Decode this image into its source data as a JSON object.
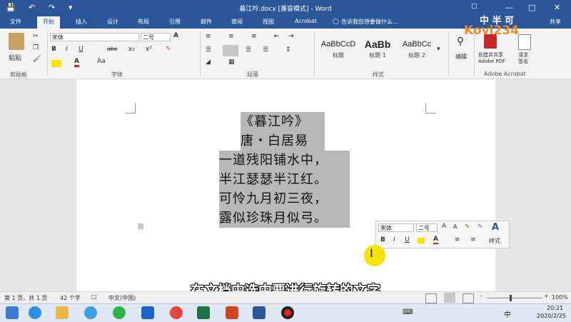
{
  "window": {
    "title": "暮江吟.docx [兼容模式] - Word",
    "share_label": "共享"
  },
  "tabs": [
    "文件",
    "开始",
    "插入",
    "设计",
    "布局",
    "引用",
    "邮件",
    "审阅",
    "视图",
    "Acrobat"
  ],
  "active_tab": "开始",
  "tell_me_placeholder": "告诉我您想要做什么...",
  "ribbon": {
    "clipboard": {
      "paste_label": "粘贴",
      "group_label": "剪贴板"
    },
    "font": {
      "font_name": "宋体",
      "font_size": "二号",
      "group_label": "字体",
      "grow_font": "A",
      "shrink_font": "A",
      "aa_label": "Aa",
      "clear_format": "A",
      "bold": "B",
      "italic": "I",
      "underline": "U",
      "strike": "abc",
      "subscript": "x₂",
      "superscript": "x²"
    },
    "paragraph": {
      "group_label": "段落"
    },
    "styles": {
      "group_label": "样式",
      "items": [
        {
          "sample": "AaBbCcD",
          "name": "标题"
        },
        {
          "sample": "AaBb",
          "name": "标题 1"
        },
        {
          "sample": "AaBbCc",
          "name": "标题 2"
        }
      ]
    },
    "editing": {
      "label": "编辑"
    },
    "acrobat": {
      "group_label": "Adobe Acrobat",
      "create_share": "创建并共享\nAdobe PDF",
      "request_sign": "请求\n签名"
    }
  },
  "document": {
    "lines": [
      "《暮江吟》",
      "唐・白居易",
      "一道残阳铺水中，",
      "半江瑟瑟半江红。",
      "可怜九月初三夜，",
      "露似珍珠月似弓。"
    ]
  },
  "mini_toolbar": {
    "font_name": "宋体",
    "font_size": "二号",
    "styles_label": "样式",
    "bold": "B",
    "italic": "I",
    "underline": "U"
  },
  "subtitle": "在文档中选中要进行旋转的文字",
  "status_bar": {
    "page_info": "第 1 页，共 1 页",
    "word_count": "42 个字",
    "language": "中文(中国)",
    "zoom": "100%"
  },
  "taskbar": {
    "time": "20:21",
    "date": "2020/2/25",
    "ime": "中"
  },
  "watermark": {
    "top_text": "中  半  可",
    "logo_text": "Kovi234"
  },
  "colors": {
    "word_blue": "#2b579a",
    "selection": "#b8b8b8",
    "highlight_yellow": "#f6e400",
    "font_red": "#e0201a"
  }
}
